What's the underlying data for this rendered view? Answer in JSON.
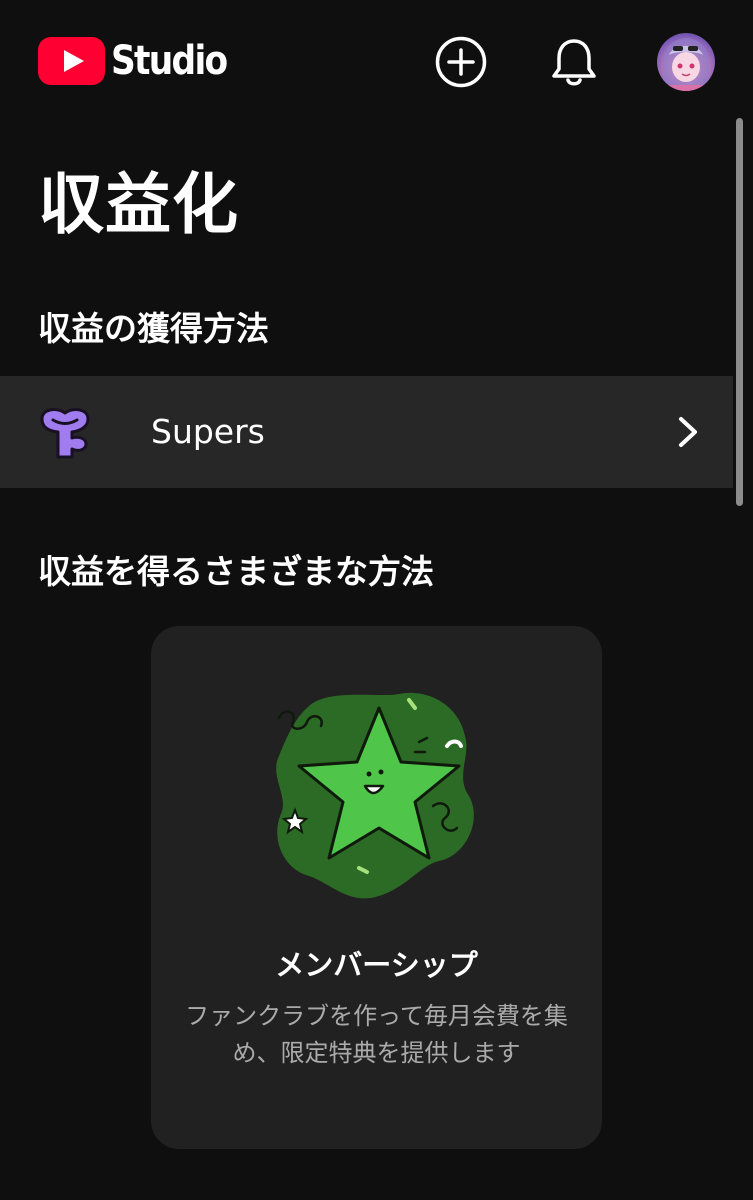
{
  "header": {
    "logo_text": "Studio",
    "icons": {
      "create": "create-plus-icon",
      "notifications": "bell-icon",
      "avatar": "avatar"
    },
    "brand_color": "#ff0033"
  },
  "page": {
    "title": "収益化"
  },
  "earn_section": {
    "title": "収益の獲得方法",
    "items": [
      {
        "label": "Supers",
        "icon": "supers-icon",
        "chevron": "chevron-right-icon"
      }
    ]
  },
  "ways_section": {
    "title": "収益を得るさまざまな方法",
    "cards": [
      {
        "title": "メンバーシップ",
        "description": "ファンクラブを作って毎月会費を集め、限定特典を提供します",
        "illustration": "membership-star-illustration"
      }
    ]
  },
  "colors": {
    "background": "#0f0f0f",
    "row_background": "#272727",
    "card_background": "#212121",
    "supers_purple": "#a07cf0",
    "star_green": "#4fc54a",
    "secondary_text": "#aaaaaa"
  }
}
